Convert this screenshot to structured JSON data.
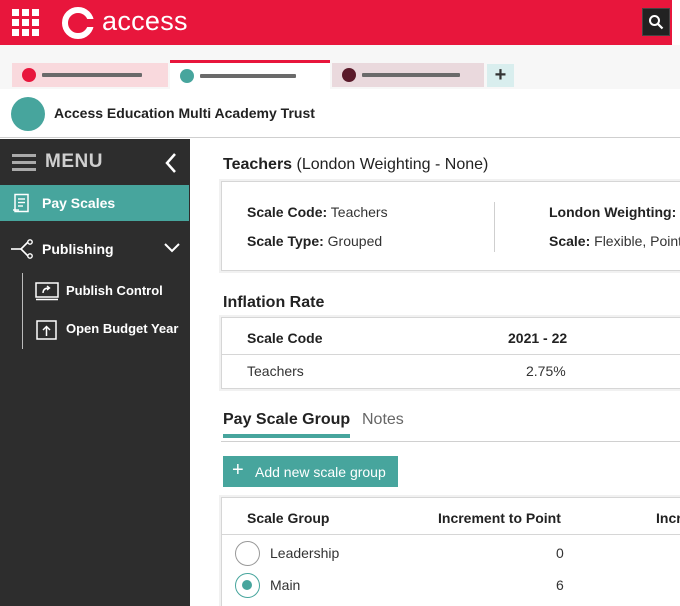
{
  "header": {
    "brand": "access"
  },
  "org": {
    "name": "Access Education Multi Academy Trust"
  },
  "colors": {
    "brand_red": "#e8163c",
    "accent_teal": "#47a59d",
    "sidebar_bg": "#2d2d2d"
  },
  "sidebar": {
    "menu_label": "MENU",
    "items": [
      {
        "label": "Pay Scales",
        "icon": "document-icon",
        "active": true
      },
      {
        "label": "Publishing",
        "icon": "share-icon",
        "expanded": true
      }
    ],
    "subitems": [
      {
        "label": "Publish Control",
        "icon": "publish-control-icon"
      },
      {
        "label": "Open Budget Year",
        "icon": "open-budget-icon"
      }
    ]
  },
  "main": {
    "title_bold": "Teachers",
    "title_rest": " (London Weighting - None)",
    "details": {
      "scale_code_label": "Scale Code:",
      "scale_code_value": " Teachers",
      "scale_type_label": "Scale Type:",
      "scale_type_value": " Grouped",
      "london_weighting_label": "London Weighting:",
      "london_weighting_value": "",
      "scale_label": "Scale:",
      "scale_value": " Flexible, Point"
    },
    "inflation": {
      "title": "Inflation Rate",
      "headers": [
        "Scale Code",
        "2021 - 22"
      ],
      "rows": [
        [
          "Teachers",
          "2.75%"
        ]
      ]
    },
    "tabs": [
      {
        "label": "Pay Scale Group",
        "active": true
      },
      {
        "label": "Notes",
        "active": false
      }
    ],
    "add_button_label": "Add new scale group",
    "groups": {
      "headers": [
        "Scale Group",
        "Increment to Point",
        "Incr"
      ],
      "rows": [
        {
          "name": "Leadership",
          "value": "0",
          "selected": false
        },
        {
          "name": "Main",
          "value": "6",
          "selected": true
        }
      ]
    }
  }
}
